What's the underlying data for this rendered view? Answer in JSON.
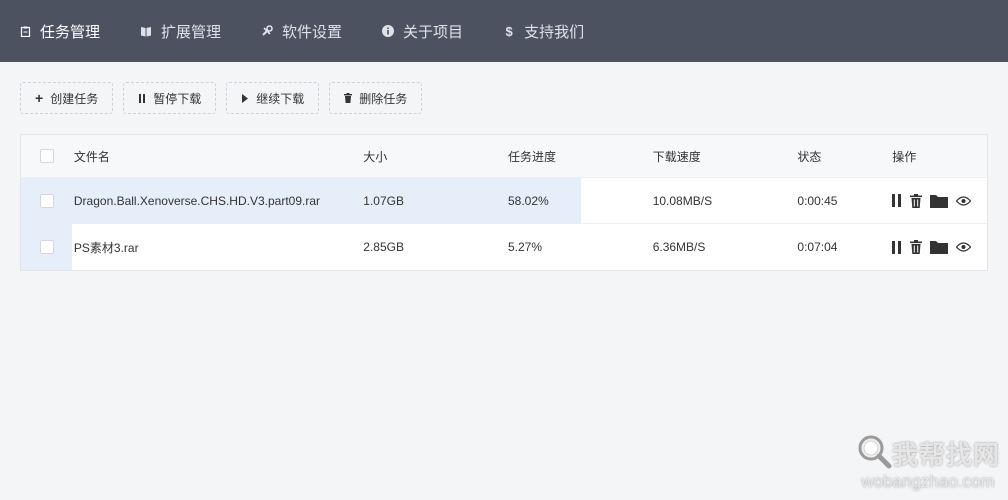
{
  "nav": {
    "items": [
      {
        "label": "任务管理",
        "icon": "clipboard-icon",
        "active": true
      },
      {
        "label": "扩展管理",
        "icon": "book-icon",
        "active": false
      },
      {
        "label": "软件设置",
        "icon": "wrench-icon",
        "active": false
      },
      {
        "label": "关于项目",
        "icon": "info-icon",
        "active": false
      },
      {
        "label": "支持我们",
        "icon": "dollar-icon",
        "active": false
      }
    ]
  },
  "toolbar": {
    "create_label": "创建任务",
    "pause_label": "暂停下载",
    "resume_label": "继续下载",
    "delete_label": "删除任务"
  },
  "table": {
    "headers": {
      "name": "文件名",
      "size": "大小",
      "progress": "任务进度",
      "speed": "下载速度",
      "status": "状态",
      "ops": "操作"
    },
    "rows": [
      {
        "name": "Dragon.Ball.Xenoverse.CHS.HD.V3.part09.rar",
        "size": "1.07GB",
        "progress": "58.02%",
        "progress_value": 0.5802,
        "speed": "10.08MB/S",
        "status": "0:00:45"
      },
      {
        "name": "PS素材3.rar",
        "size": "2.85GB",
        "progress": "5.27%",
        "progress_value": 0.0527,
        "speed": "6.36MB/S",
        "status": "0:07:04"
      }
    ]
  },
  "watermark": {
    "text": "我帮找网",
    "url": "wobangzhao.com"
  },
  "colors": {
    "nav_bg": "#4c5260",
    "progress_fill": "#e6eff9"
  }
}
